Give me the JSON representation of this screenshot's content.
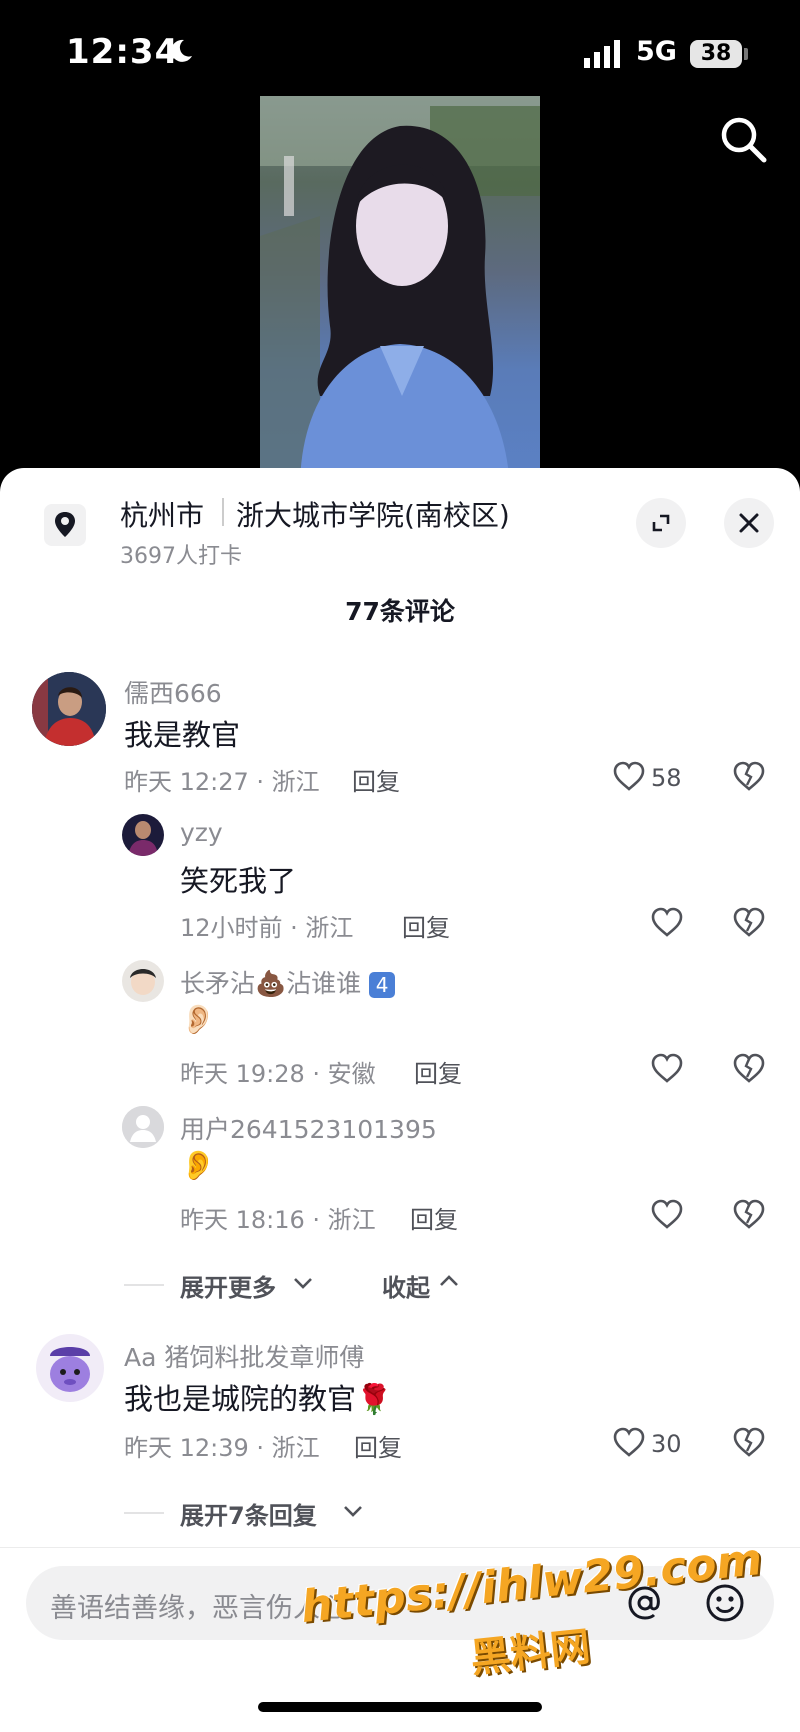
{
  "status_bar": {
    "time": "12:34",
    "network": "5G",
    "battery": "38"
  },
  "location": {
    "city": "杭州市",
    "place": "浙大城市学院(南校区)",
    "checkins": "3697人打卡"
  },
  "comment_count": "77条评论",
  "comments": [
    {
      "user": "儒西666",
      "text": "我是教官",
      "meta": "昨天 12:27 · 浙江",
      "reply": "回复",
      "likes": "58",
      "replies": [
        {
          "user": "yzy",
          "text": "笑死我了",
          "meta": "12小时前 · 浙江",
          "reply": "回复"
        },
        {
          "user": "长矛沾💩沾谁谁",
          "badge": "4",
          "text": "👂🏻",
          "meta": "昨天 19:28 · 安徽",
          "reply": "回复"
        },
        {
          "user": "用户2641523101395",
          "text": "👂",
          "meta": "昨天 18:16 · 浙江",
          "reply": "回复"
        }
      ],
      "expand_more": "展开更多",
      "collapse": "收起"
    },
    {
      "user": "Aa 猪饲料批发章师傅",
      "text": "我也是城院的教官🌹",
      "meta": "昨天 12:39 · 浙江",
      "reply": "回复",
      "likes": "30",
      "expand_replies": "展开7条回复"
    }
  ],
  "input": {
    "placeholder": "善语结善缘，恶言伤人心"
  },
  "watermark": {
    "url": "https://ihlw29.com",
    "name": "黑料网"
  },
  "icons": [
    "moon-icon",
    "signal-icon",
    "search-icon",
    "location-pin-icon",
    "expand-icon",
    "close-icon",
    "heart-icon",
    "broken-heart-icon",
    "chevron-down-icon",
    "chevron-up-icon",
    "at-icon",
    "emoji-icon"
  ]
}
